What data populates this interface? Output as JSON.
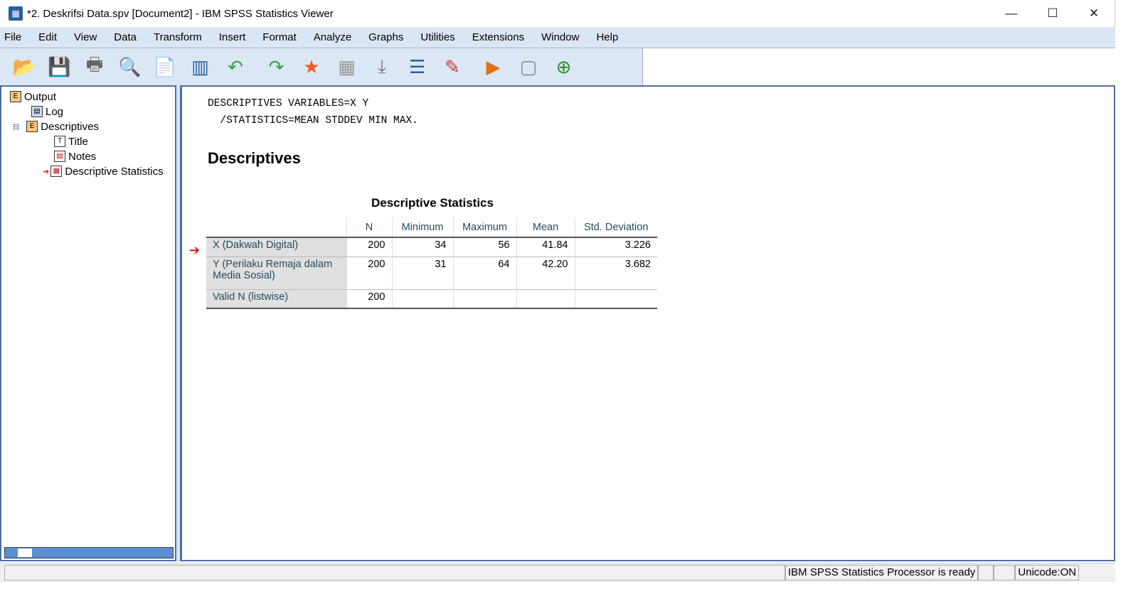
{
  "window": {
    "title": "*2. Deskrifsi Data.spv [Document2] - IBM SPSS Statistics Viewer",
    "minimize": "—",
    "maximize": "☐",
    "close": "✕"
  },
  "menu": [
    "File",
    "Edit",
    "View",
    "Data",
    "Transform",
    "Insert",
    "Format",
    "Analyze",
    "Graphs",
    "Utilities",
    "Extensions",
    "Window",
    "Help"
  ],
  "toolbar": [
    {
      "name": "open-icon",
      "glyph": "📂"
    },
    {
      "name": "save-icon",
      "glyph": "💾"
    },
    {
      "name": "print-icon",
      "glyph": "🖶"
    },
    {
      "name": "print-preview-icon",
      "glyph": "🔍"
    },
    {
      "name": "export-icon",
      "glyph": "📄"
    },
    {
      "name": "recall-dialog-icon",
      "glyph": "▥"
    },
    {
      "name": "undo-icon",
      "glyph": "↶"
    },
    {
      "name": "redo-icon",
      "glyph": "↷"
    },
    {
      "name": "goto-data-icon",
      "glyph": "★"
    },
    {
      "name": "goto-case-icon",
      "glyph": "▦"
    },
    {
      "name": "goto-variable-icon",
      "glyph": "⤓"
    },
    {
      "name": "variables-icon",
      "glyph": "☰"
    },
    {
      "name": "insert-text-icon",
      "glyph": "✎"
    },
    {
      "name": "run-script-icon",
      "glyph": "▶"
    },
    {
      "name": "designate-window-icon",
      "glyph": "▢"
    },
    {
      "name": "promote-icon",
      "glyph": "⊕"
    }
  ],
  "tree": {
    "output": "Output",
    "log": "Log",
    "descriptives": "Descriptives",
    "title": "Title",
    "notes": "Notes",
    "descstats": "Descriptive Statistics"
  },
  "syntax": {
    "line1": "DESCRIPTIVES VARIABLES=X Y",
    "line2": "  /STATISTICS=MEAN STDDEV MIN MAX."
  },
  "heading": "Descriptives",
  "table": {
    "title": "Descriptive Statistics",
    "columns": [
      "",
      "N",
      "Minimum",
      "Maximum",
      "Mean",
      "Std. Deviation"
    ],
    "rows": [
      {
        "label": "X (Dakwah Digital)",
        "n": "200",
        "min": "34",
        "max": "56",
        "mean": "41.84",
        "sd": "3.226"
      },
      {
        "label": "Y (Perilaku Remaja dalam Media Sosial)",
        "n": "200",
        "min": "31",
        "max": "64",
        "mean": "42.20",
        "sd": "3.682"
      },
      {
        "label": "Valid N (listwise)",
        "n": "200",
        "min": "",
        "max": "",
        "mean": "",
        "sd": ""
      }
    ]
  },
  "status": {
    "processor": "IBM SPSS Statistics Processor is ready",
    "unicode": "Unicode:ON"
  }
}
